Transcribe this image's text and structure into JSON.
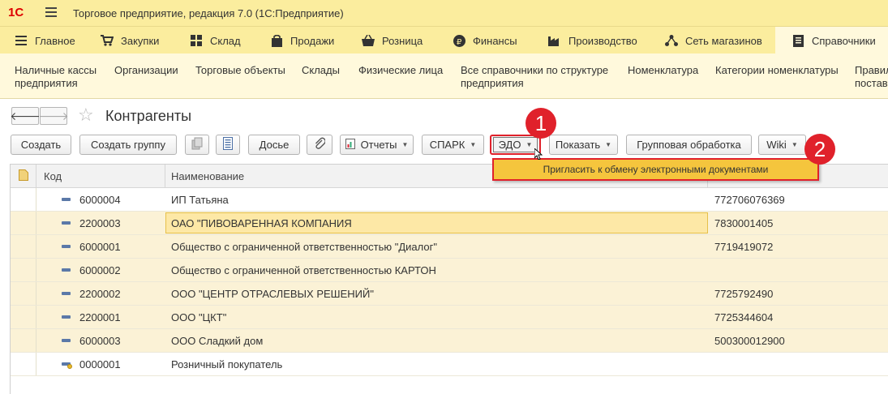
{
  "app": {
    "logo": "1С",
    "title": "Торговое предприятие, редакция 7.0  (1С:Предприятие)"
  },
  "sections": [
    {
      "label": "Главное",
      "icon": "burger-icon"
    },
    {
      "label": "Закупки",
      "icon": "cart-icon"
    },
    {
      "label": "Склад",
      "icon": "grid-icon"
    },
    {
      "label": "Продажи",
      "icon": "bag-icon"
    },
    {
      "label": "Розница",
      "icon": "basket-icon"
    },
    {
      "label": "Финансы",
      "icon": "ruble-icon"
    },
    {
      "label": "Производство",
      "icon": "factory-icon"
    },
    {
      "label": "Сеть магазинов",
      "icon": "network-icon"
    },
    {
      "label": "Справочники",
      "icon": "book-icon"
    }
  ],
  "nav": [
    {
      "line1": "Наличные кассы",
      "line2": "предприятия"
    },
    {
      "line1": "Организации",
      "line2": ""
    },
    {
      "line1": "Торговые объекты",
      "line2": ""
    },
    {
      "line1": "Склады",
      "line2": ""
    },
    {
      "line1": "Физические лица",
      "line2": ""
    },
    {
      "line1": "Все справочники по структуре",
      "line2": "предприятия"
    },
    {
      "line1": "Номенклатура",
      "line2": ""
    },
    {
      "line1": "Категории номенклатуры",
      "line2": ""
    },
    {
      "line1": "Правил",
      "line2": "постав"
    }
  ],
  "form": {
    "back": "🡐",
    "forward": "🡒",
    "star": "☆",
    "title": "Контрагенты"
  },
  "toolbar": {
    "create": "Создать",
    "create_group": "Создать группу",
    "dossier": "Досье",
    "reports": "Отчеты",
    "spark": "СПАРК",
    "edo": "ЭДО",
    "show": "Показать",
    "group_processing": "Групповая обработка",
    "wiki": "Wiki"
  },
  "dropdown": {
    "item": "Пригласить к обмену электронными документами"
  },
  "badges": {
    "one": "1",
    "two": "2"
  },
  "table": {
    "headers": {
      "code": "Код",
      "name": "Наименование"
    },
    "rows": [
      {
        "code": "6000004",
        "name": "ИП Татьяна",
        "inn": "772706076369"
      },
      {
        "code": "2200003",
        "name": "ОАО \"ПИВОВАРЕННАЯ КОМПАНИЯ",
        "inn": "7830001405"
      },
      {
        "code": "6000001",
        "name": "Общество с ограниченной ответственностью \"Диалог\"",
        "inn": "7719419072"
      },
      {
        "code": "6000002",
        "name": "Общество с ограниченной ответственностью КАРТОН",
        "inn": ""
      },
      {
        "code": "2200002",
        "name": "ООО \"ЦЕНТР ОТРАСЛЕВЫХ РЕШЕНИЙ\"",
        "inn": "7725792490"
      },
      {
        "code": "2200001",
        "name": "ООО \"ЦКТ\"",
        "inn": "7725344604"
      },
      {
        "code": "6000003",
        "name": "ООО Сладкий дом",
        "inn": "500300012900"
      },
      {
        "code": "0000001",
        "name": "Розничный покупатель",
        "inn": ""
      }
    ]
  },
  "colors": {
    "accent_red": "#e0212b",
    "panel_yellow": "#fbed9e",
    "highlight": "#f5c53d"
  }
}
